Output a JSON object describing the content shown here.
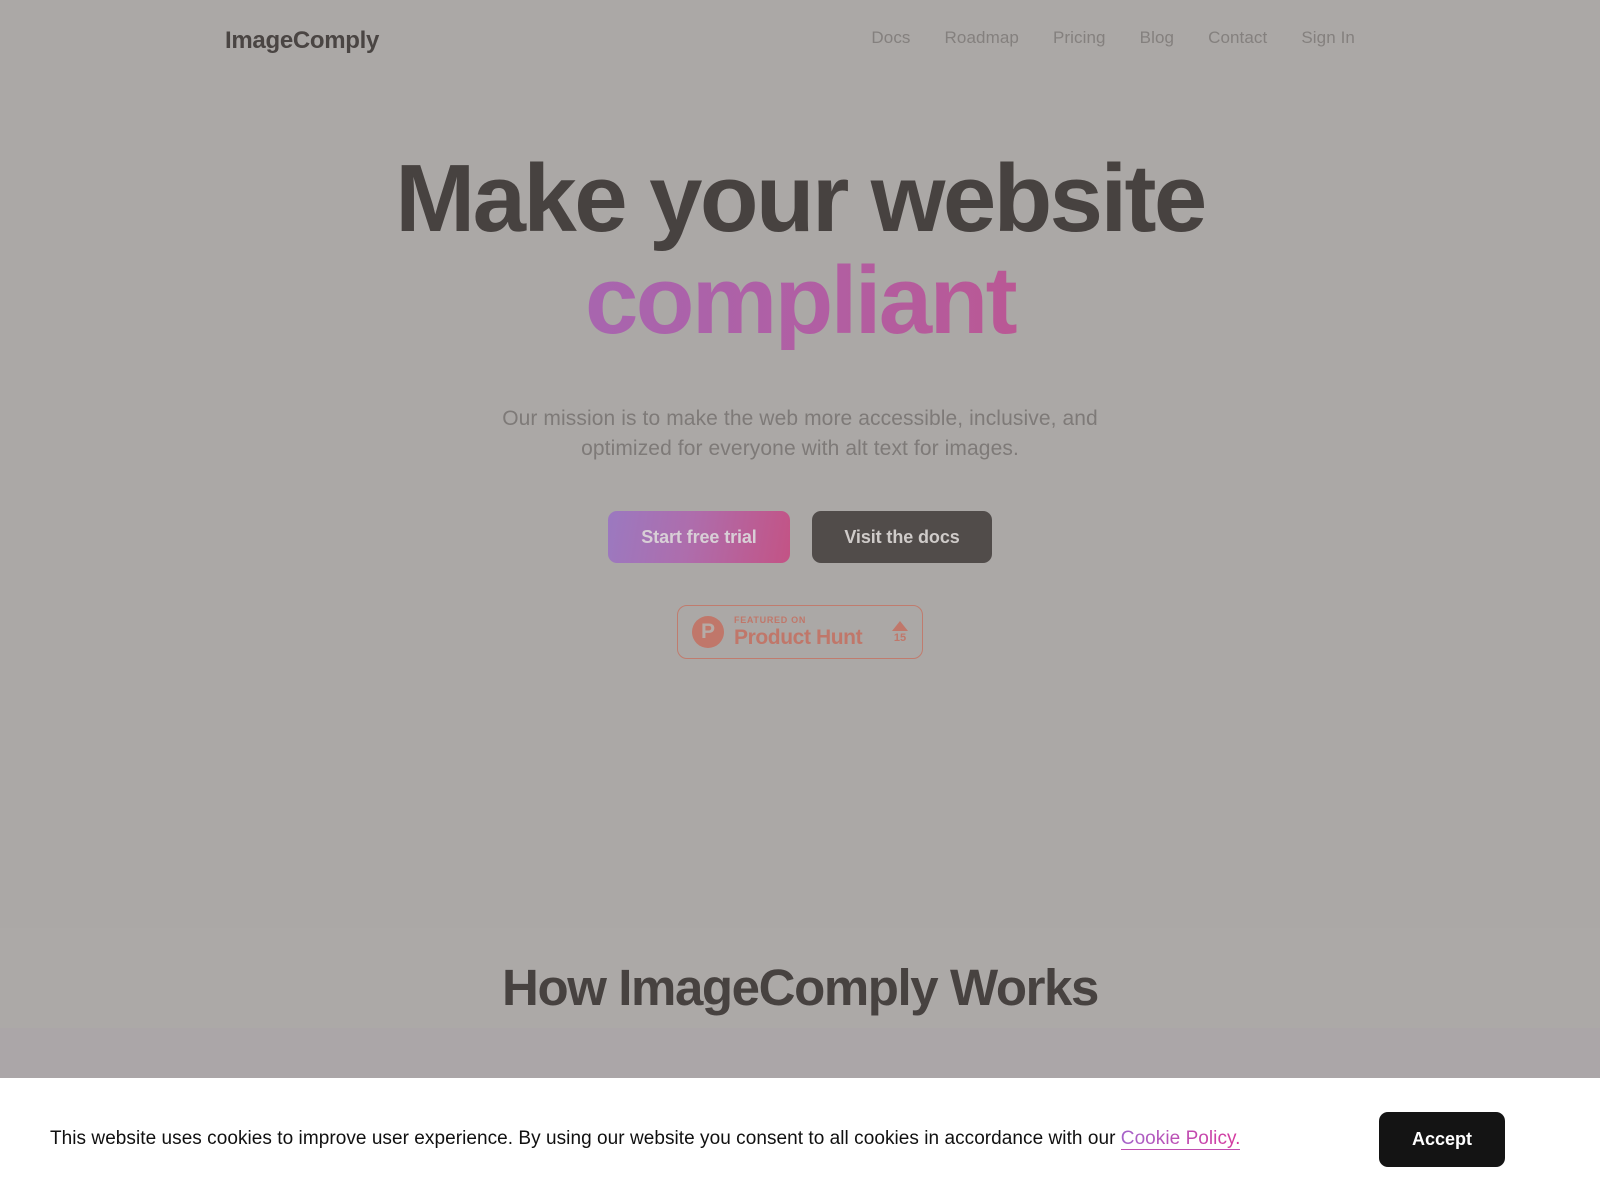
{
  "header": {
    "brand": "ImageComply",
    "nav": [
      {
        "label": "Docs",
        "name": "nav-link-docs"
      },
      {
        "label": "Roadmap",
        "name": "nav-link-roadmap"
      },
      {
        "label": "Pricing",
        "name": "nav-link-pricing"
      },
      {
        "label": "Blog",
        "name": "nav-link-blog"
      },
      {
        "label": "Contact",
        "name": "nav-link-contact"
      },
      {
        "label": "Sign In",
        "name": "nav-link-sign-in"
      }
    ]
  },
  "hero": {
    "title_line1": "Make your website",
    "title_line2": "compliant",
    "subtitle_line1": "Our mission is to make the web more accessible, inclusive, and",
    "subtitle_line2": "optimized for everyone with alt text for images.",
    "primary_cta": "Start free trial",
    "secondary_cta": "Visit the docs",
    "gradient_start": "#8E6FC3",
    "gradient_end": "#CE4473"
  },
  "product_hunt": {
    "logo_letter": "P",
    "featured_label": "FEATURED ON",
    "name": "Product Hunt",
    "upvotes": "15",
    "accent_color": "#C0776A"
  },
  "sections": {
    "how_it_works_heading": "How ImageComply Works"
  },
  "cookie_banner": {
    "text_before": "This website uses cookies to improve user experience. By using our website you consent to all cookies in accordance with our ",
    "link_label": "Cookie Policy.",
    "accept_label": "Accept",
    "accept_bg": "#141414"
  },
  "colors": {
    "page_background": "#ABA8A6",
    "heading_text": "#474240",
    "body_text": "#7E7A78"
  }
}
